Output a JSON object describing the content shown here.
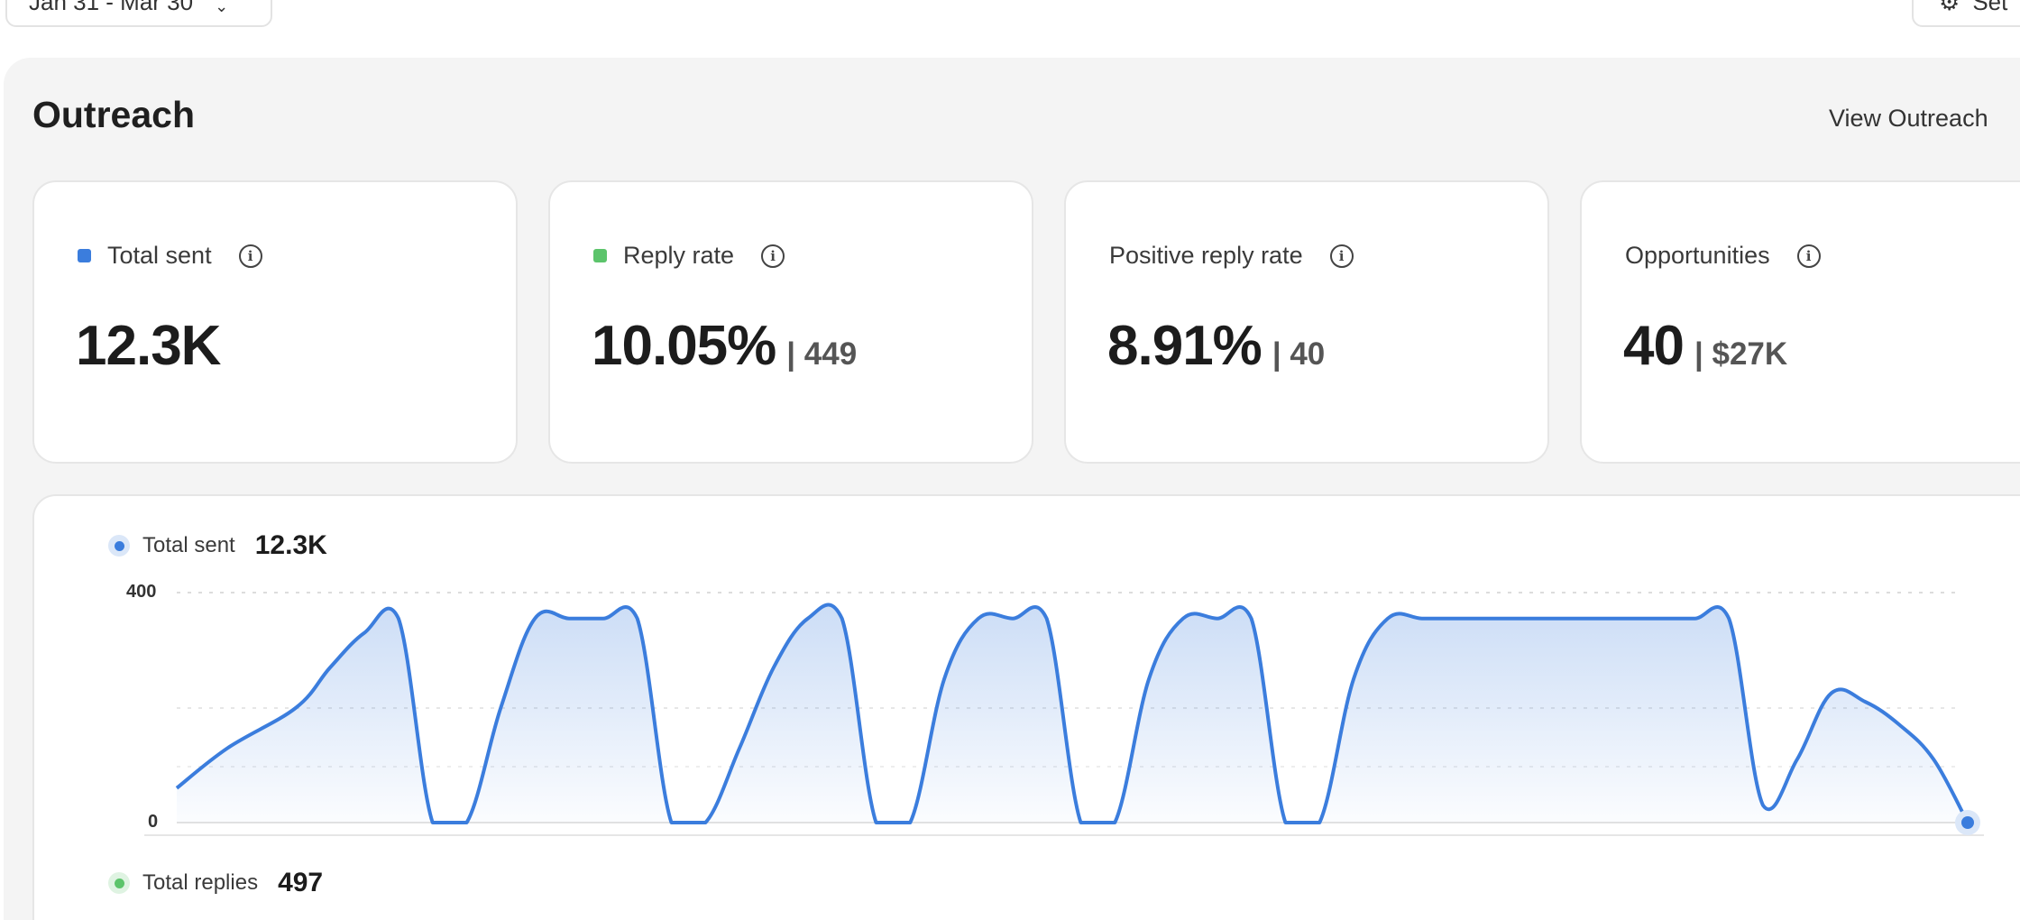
{
  "date_range": {
    "label": "Jan 31 - Mar 30",
    "icon": "chevron-down-icon"
  },
  "settings_chip": {
    "label": "Set",
    "icon": "gear-icon"
  },
  "section": {
    "title": "Outreach",
    "view_link": "View Outreach"
  },
  "cards": [
    {
      "label": "Total sent",
      "value": "12.3K",
      "sub": "",
      "marker_color": "#3b7ddd",
      "icon": "info-icon"
    },
    {
      "label": "Reply rate",
      "value": "10.05%",
      "sub": "| 449",
      "marker_color": "#5cc46b",
      "icon": "info-icon"
    },
    {
      "label": "Positive reply rate",
      "value": "8.91%",
      "sub": "| 40",
      "marker_color": "",
      "icon": "info-icon"
    },
    {
      "label": "Opportunities",
      "value": "40",
      "sub": "| $27K",
      "marker_color": "",
      "icon": "info-icon"
    }
  ],
  "chart_data": {
    "type": "area",
    "series": [
      {
        "name": "Total sent",
        "total": "12.3K",
        "color": "#3b7ddd"
      }
    ],
    "secondary_legend": {
      "name": "Total replies",
      "total": "497",
      "color": "#5cc46b"
    },
    "yticks": [
      "400",
      "0"
    ],
    "ylim": [
      0,
      400
    ],
    "grid": true,
    "points": [
      [
        0,
        60
      ],
      [
        3,
        130
      ],
      [
        7,
        200
      ],
      [
        9,
        270
      ],
      [
        11,
        330
      ],
      [
        13,
        355
      ],
      [
        15,
        0
      ],
      [
        17,
        0
      ],
      [
        19,
        200
      ],
      [
        21,
        355
      ],
      [
        23,
        355
      ],
      [
        25,
        355
      ],
      [
        27,
        355
      ],
      [
        29,
        0
      ],
      [
        31,
        0
      ],
      [
        33,
        130
      ],
      [
        35,
        270
      ],
      [
        37,
        355
      ],
      [
        39,
        355
      ],
      [
        41,
        0
      ],
      [
        43,
        0
      ],
      [
        45,
        250
      ],
      [
        47,
        355
      ],
      [
        49,
        355
      ],
      [
        51,
        355
      ],
      [
        53,
        0
      ],
      [
        55,
        0
      ],
      [
        57,
        250
      ],
      [
        59,
        355
      ],
      [
        61,
        355
      ],
      [
        63,
        355
      ],
      [
        65,
        0
      ],
      [
        67,
        0
      ],
      [
        69,
        250
      ],
      [
        71,
        355
      ],
      [
        73,
        355
      ],
      [
        75,
        355
      ],
      [
        77,
        355
      ],
      [
        79,
        355
      ],
      [
        81,
        355
      ],
      [
        83,
        355
      ],
      [
        85,
        355
      ],
      [
        87,
        355
      ],
      [
        89,
        355
      ],
      [
        91,
        355
      ],
      [
        93,
        30
      ],
      [
        95,
        110
      ],
      [
        97,
        225
      ],
      [
        99,
        210
      ],
      [
        101,
        170
      ],
      [
        103,
        110
      ],
      [
        105,
        0
      ]
    ]
  }
}
